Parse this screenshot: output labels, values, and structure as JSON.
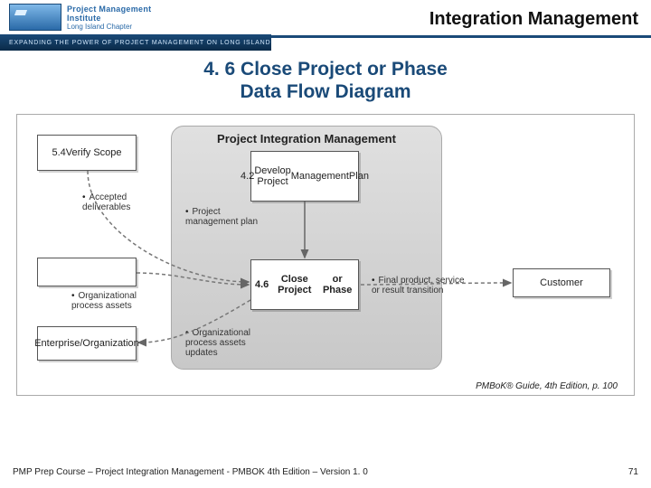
{
  "header": {
    "topic": "Integration Management",
    "org_line1": "Project Management Institute",
    "org_line2": "Long Island Chapter",
    "strip": "EXPANDING THE POWER OF PROJECT MANAGEMENT ON LONG ISLAND"
  },
  "title": {
    "line1": "4. 6 Close Project or Phase",
    "line2": "Data Flow Diagram"
  },
  "diagram": {
    "panel_title": "Project Integration Management",
    "boxes": {
      "verify_scope": "5.4\nVerify Scope",
      "dev_plan": "4.2\nDevelop Project\nManagement\nPlan",
      "close": "4.6\nClose Project\nor Phase",
      "enterprise": "Enterprise/\nOrganization",
      "customer": "Customer",
      "blank": ""
    },
    "labels": {
      "accepted": "Accepted deliverables",
      "pm_plan": "Project management plan",
      "opa": "Organizational process assets",
      "opa_updates": "Organizational process assets updates",
      "final": "Final product, service or result transition"
    }
  },
  "credit": "PMBoK® Guide, 4th Edition, p. 100",
  "footer": {
    "left": "PMP Prep Course – Project Integration Management - PMBOK 4th Edition – Version 1. 0",
    "right": "71"
  }
}
